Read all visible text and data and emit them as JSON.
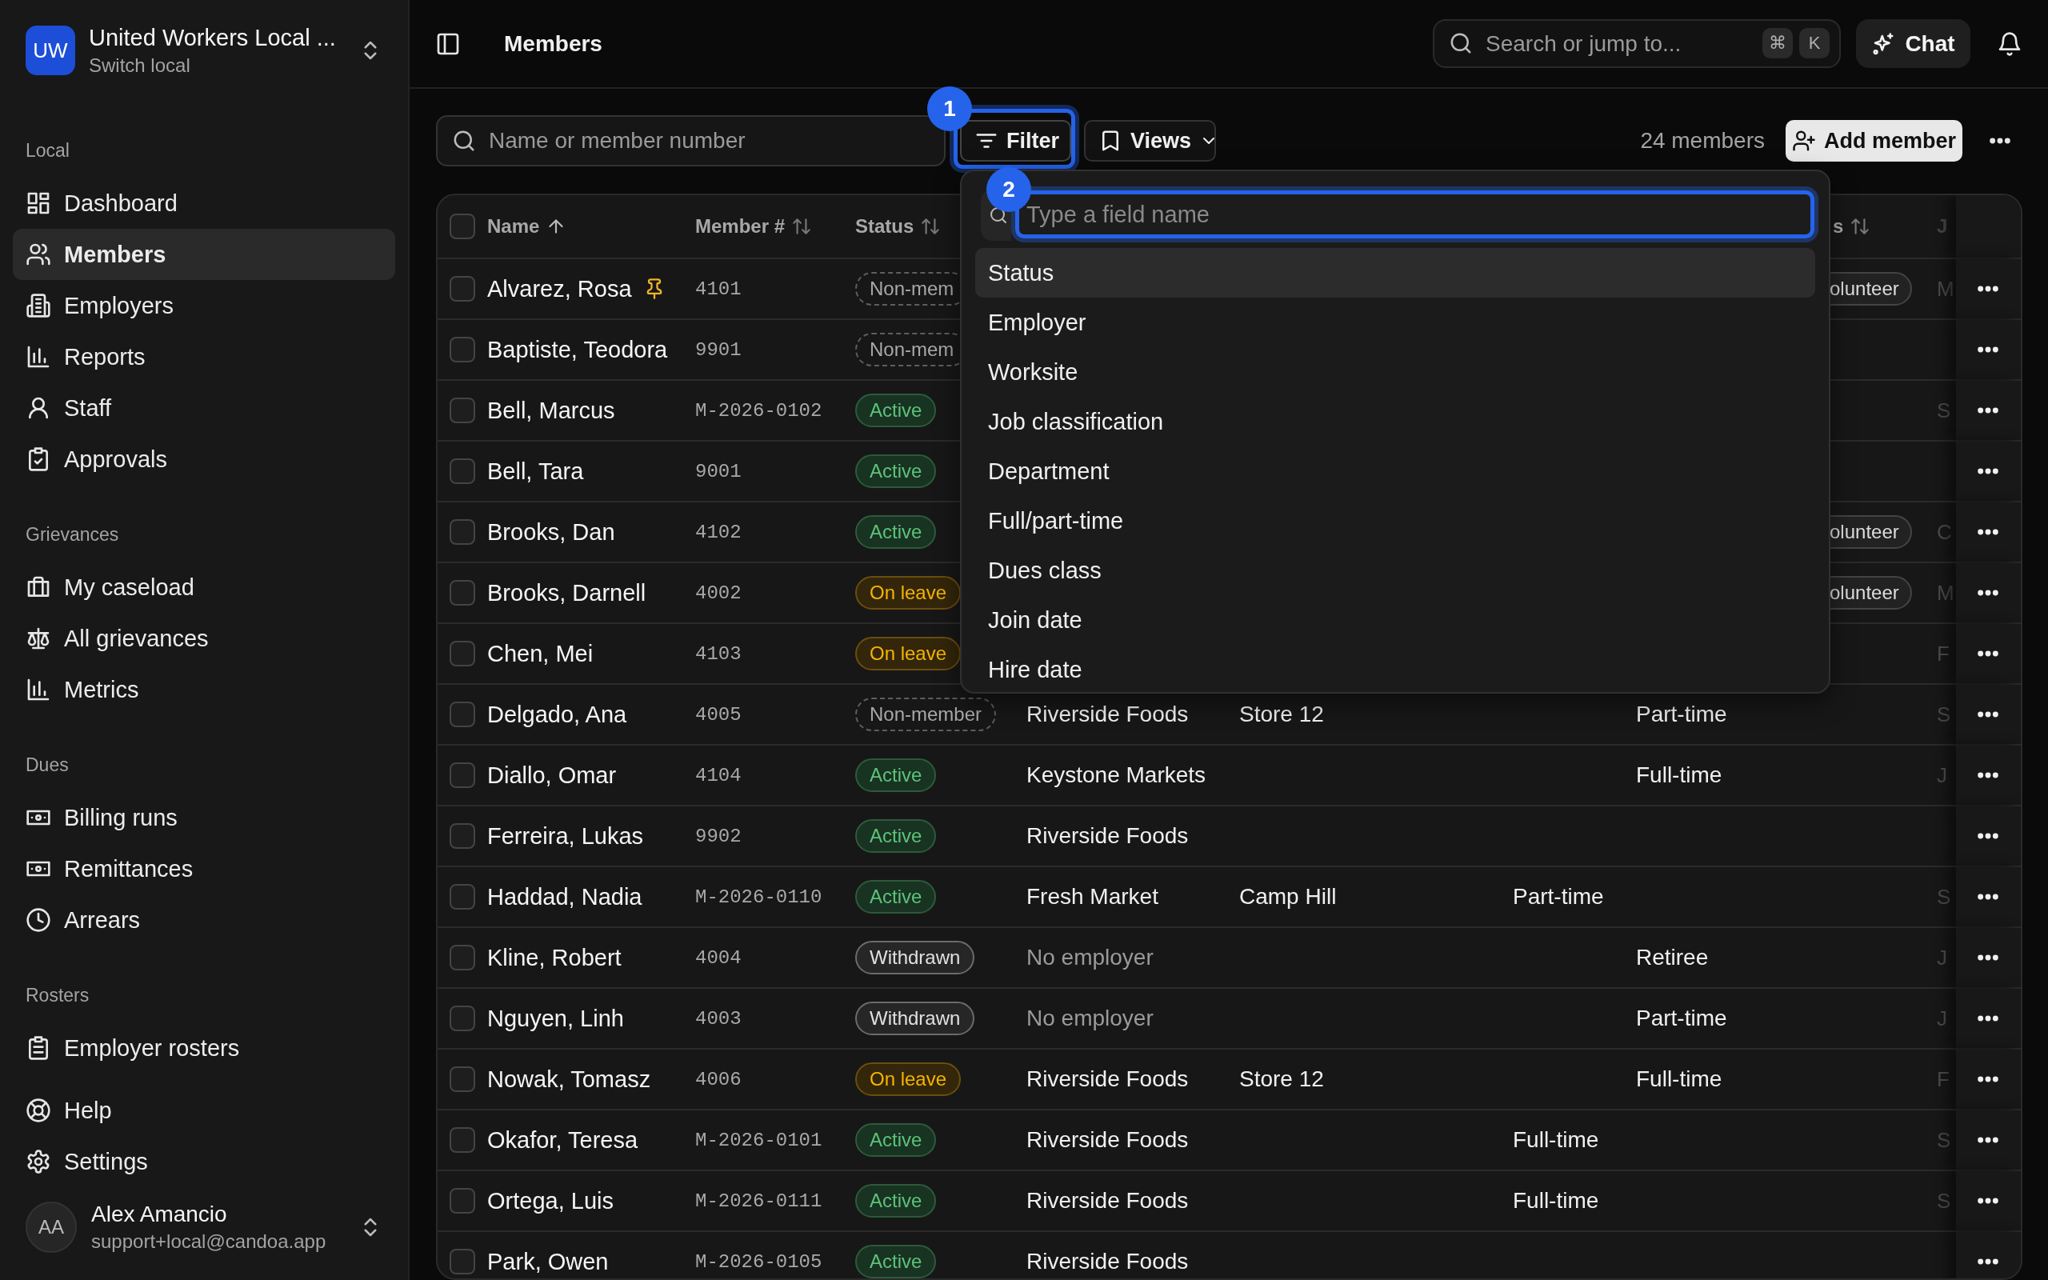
{
  "sidebar": {
    "org": {
      "initials": "UW",
      "name": "United Workers Local ...",
      "subtitle": "Switch local"
    },
    "sections": [
      {
        "label": "Local",
        "items": [
          {
            "label": "Dashboard",
            "selected": false
          },
          {
            "label": "Members",
            "selected": true
          },
          {
            "label": "Employers",
            "selected": false
          },
          {
            "label": "Reports",
            "selected": false
          },
          {
            "label": "Staff",
            "selected": false
          },
          {
            "label": "Approvals",
            "selected": false
          }
        ]
      },
      {
        "label": "Grievances",
        "items": [
          {
            "label": "My caseload",
            "selected": false
          },
          {
            "label": "All grievances",
            "selected": false
          },
          {
            "label": "Metrics",
            "selected": false
          }
        ]
      },
      {
        "label": "Dues",
        "items": [
          {
            "label": "Billing runs",
            "selected": false
          },
          {
            "label": "Remittances",
            "selected": false
          },
          {
            "label": "Arrears",
            "selected": false
          }
        ]
      },
      {
        "label": "Rosters",
        "items": [
          {
            "label": "Employer rosters",
            "selected": false
          }
        ]
      }
    ],
    "footer_items": [
      {
        "label": "Help",
        "selected": false
      },
      {
        "label": "Settings",
        "selected": false
      }
    ],
    "user": {
      "initials": "AA",
      "name": "Alex Amancio",
      "email": "support+local@candoa.app"
    }
  },
  "topbar": {
    "title": "Members",
    "search": {
      "placeholder": "Search or jump to...",
      "keys": [
        "⌘",
        "K"
      ]
    },
    "chat_button": "Chat"
  },
  "toolbar": {
    "search": {
      "placeholder": "Name or member number"
    },
    "filter_button": "Filter",
    "views_button": "Views",
    "count": "24 members",
    "add_button": "Add member"
  },
  "table": {
    "select_all_checked": false,
    "columns": [
      {
        "label": "Name",
        "sorted": true
      },
      {
        "label": "Member #",
        "sorted": false
      },
      {
        "label": "Status",
        "sorted": false
      },
      {
        "label": "s",
        "sorted": false
      },
      {
        "label": "J"
      }
    ],
    "rows": [
      {
        "checked": false,
        "name": "Alvarez, Rosa",
        "pinned": true,
        "member_no": "4101",
        "status": {
          "text": "Non-mem",
          "kind": "non_member"
        },
        "tag": "olunteer",
        "column_9": "M"
      },
      {
        "checked": false,
        "name": "Baptiste, Teodora",
        "pinned": false,
        "member_no": "9901",
        "status": {
          "text": "Non-mem",
          "kind": "non_member"
        }
      },
      {
        "checked": false,
        "name": "Bell, Marcus",
        "pinned": false,
        "member_no": "M-2026-0102",
        "status": {
          "text": "Active",
          "kind": "active"
        },
        "column_9": "S"
      },
      {
        "checked": false,
        "name": "Bell, Tara",
        "pinned": false,
        "member_no": "9001",
        "status": {
          "text": "Active",
          "kind": "active"
        }
      },
      {
        "checked": false,
        "name": "Brooks, Dan",
        "pinned": false,
        "member_no": "4102",
        "status": {
          "text": "Active",
          "kind": "active"
        },
        "tag": "olunteer",
        "column_9": "C"
      },
      {
        "checked": false,
        "name": "Brooks, Darnell",
        "pinned": false,
        "member_no": "4002",
        "status": {
          "text": "On leave",
          "kind": "on_leave"
        },
        "tag": "olunteer",
        "column_9": "M"
      },
      {
        "checked": false,
        "name": "Chen, Mei",
        "pinned": false,
        "member_no": "4103",
        "status": {
          "text": "On leave",
          "kind": "on_leave"
        },
        "column_9": "F"
      },
      {
        "checked": false,
        "name": "Delgado, Ana",
        "pinned": false,
        "member_no": "4005",
        "status": {
          "text": "Non-member",
          "kind": "non_member"
        },
        "employer": "Riverside Foods",
        "employer_muted": false,
        "worksite": "Store 12",
        "column_7": "Part-time",
        "column_9": "S"
      },
      {
        "checked": false,
        "name": "Diallo, Omar",
        "pinned": false,
        "member_no": "4104",
        "status": {
          "text": "Active",
          "kind": "active"
        },
        "employer": "Keystone Markets",
        "employer_muted": false,
        "column_7": "Full-time",
        "column_9": "J"
      },
      {
        "checked": false,
        "name": "Ferreira, Lukas",
        "pinned": false,
        "member_no": "9902",
        "status": {
          "text": "Active",
          "kind": "active"
        },
        "employer": "Riverside Foods",
        "employer_muted": false
      },
      {
        "checked": false,
        "name": "Haddad, Nadia",
        "pinned": false,
        "member_no": "M-2026-0110",
        "status": {
          "text": "Active",
          "kind": "active"
        },
        "employer": "Fresh Market",
        "employer_muted": false,
        "worksite": "Camp Hill",
        "column_6": "Part-time",
        "column_9": "S"
      },
      {
        "checked": false,
        "name": "Kline, Robert",
        "pinned": false,
        "member_no": "4004",
        "status": {
          "text": "Withdrawn",
          "kind": "withdrawn"
        },
        "employer": "No employer",
        "employer_muted": true,
        "column_7": "Retiree",
        "column_9": "J"
      },
      {
        "checked": false,
        "name": "Nguyen, Linh",
        "pinned": false,
        "member_no": "4003",
        "status": {
          "text": "Withdrawn",
          "kind": "withdrawn"
        },
        "employer": "No employer",
        "employer_muted": true,
        "column_7": "Part-time",
        "column_9": "J"
      },
      {
        "checked": false,
        "name": "Nowak, Tomasz",
        "pinned": false,
        "member_no": "4006",
        "status": {
          "text": "On leave",
          "kind": "on_leave"
        },
        "employer": "Riverside Foods",
        "employer_muted": false,
        "worksite": "Store 12",
        "column_7": "Full-time",
        "column_9": "F"
      },
      {
        "checked": false,
        "name": "Okafor, Teresa",
        "pinned": false,
        "member_no": "M-2026-0101",
        "status": {
          "text": "Active",
          "kind": "active"
        },
        "employer": "Riverside Foods",
        "employer_muted": false,
        "column_6": "Full-time",
        "column_9": "S"
      },
      {
        "checked": false,
        "name": "Ortega, Luis",
        "pinned": false,
        "member_no": "M-2026-0111",
        "status": {
          "text": "Active",
          "kind": "active"
        },
        "employer": "Riverside Foods",
        "employer_muted": false,
        "column_6": "Full-time",
        "column_9": "S"
      },
      {
        "checked": false,
        "name": "Park, Owen",
        "pinned": false,
        "member_no": "M-2026-0105",
        "status": {
          "text": "Active",
          "kind": "active"
        },
        "employer": "Riverside Foods",
        "employer_muted": false
      }
    ]
  },
  "filter_menu": {
    "search": {
      "placeholder": "Type a field name"
    },
    "items": [
      {
        "label": "Status",
        "selected": true
      },
      {
        "label": "Employer",
        "selected": false
      },
      {
        "label": "Worksite",
        "selected": false
      },
      {
        "label": "Job classification",
        "selected": false
      },
      {
        "label": "Department",
        "selected": false
      },
      {
        "label": "Full/part-time",
        "selected": false
      },
      {
        "label": "Dues class",
        "selected": false
      },
      {
        "label": "Join date",
        "selected": false
      },
      {
        "label": "Hire date",
        "selected": false
      }
    ]
  },
  "annotations": [
    {
      "number": "1"
    },
    {
      "number": "2"
    }
  ]
}
